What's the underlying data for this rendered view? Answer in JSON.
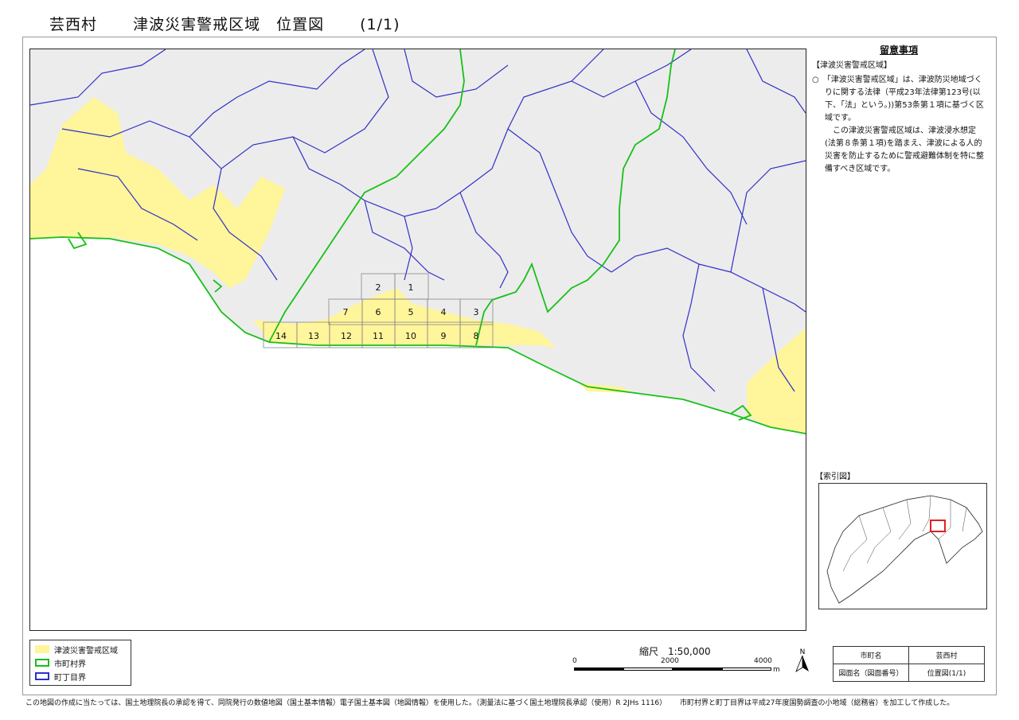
{
  "header": {
    "village": "芸西村",
    "map_title": "津波災害警戒区域　位置図",
    "page": "(1/1)"
  },
  "notes": {
    "heading": "留意事項",
    "section": "【津波災害警戒区域】",
    "para1": "○　「津波災害警戒区域」は、津波防災地域づくりに関する法律（平成23年法律第123号(以下、「法」という。))第53条第１項に基づく区域です。",
    "para2": "この津波災害警戒区域は、津波浸水想定(法第８条第１項)を踏まえ、津波による人的災害を防止するために警戒避難体制を特に整備すべき区域です。"
  },
  "index_map": {
    "label": "【索引図】",
    "highlight_color": "#e02020"
  },
  "map": {
    "grid_labels_top": [
      "2",
      "1"
    ],
    "grid_labels_mid": [
      "7",
      "6",
      "5",
      "4",
      "3"
    ],
    "grid_labels_bottom": [
      "14",
      "13",
      "12",
      "11",
      "10",
      "9",
      "8"
    ],
    "colors": {
      "zone": "#fff59a",
      "municipal_boundary": "#18c018",
      "district_boundary": "#3030c8",
      "terrain": "#e9e9e9"
    }
  },
  "legend": {
    "items": [
      {
        "label": "津波災害警戒区域",
        "color": "#fff59a"
      },
      {
        "label": "市町村界",
        "color": "#18c018"
      },
      {
        "label": "町丁目界",
        "color": "#3030c8"
      }
    ]
  },
  "scale": {
    "title": "縮尺　1:50,000",
    "ticks": [
      "0",
      "2000",
      "4000"
    ],
    "unit": "m"
  },
  "north": {
    "label": "N"
  },
  "info_table": {
    "row1_key": "市町名",
    "row1_val": "芸西村",
    "row2_key": "図面名（図面番号）",
    "row2_val": "位置図(1/1)"
  },
  "footer": {
    "text_a": "この地図の作成に当たっては、国土地理院長の承認を得て、同院発行の数値地図（国土基本情報）電子国土基本図（地図情報）を使用した。（測量法に基づく国土地理院長承認（使用）R 2JHs 1116）",
    "text_b": "市町村界と町丁目界は平成27年度国勢調査の小地域（総務省）を加工して作成した。"
  }
}
